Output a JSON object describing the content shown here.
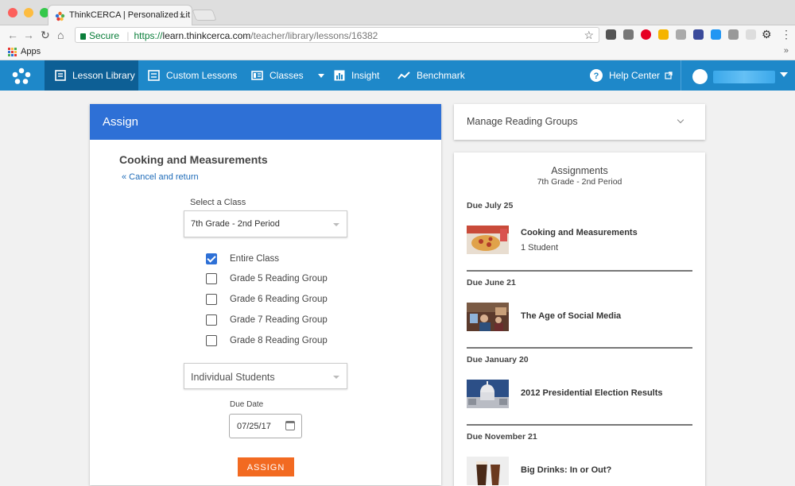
{
  "browser": {
    "tab_title": "ThinkCERCA | Personalized Lit",
    "secure_label": "Secure",
    "url_scheme": "https://",
    "url_host": "learn.thinkcerca.com",
    "url_path": "/teacher/library/lessons/16382",
    "bookmarks": {
      "apps_label": "Apps",
      "more": "»"
    }
  },
  "nav": {
    "items": [
      {
        "label": "Lesson Library"
      },
      {
        "label": "Custom Lessons"
      },
      {
        "label": "Classes"
      },
      {
        "label": "Insight"
      },
      {
        "label": "Benchmark"
      }
    ],
    "help_label": "Help Center",
    "colors": {
      "bar": "#1e88c9",
      "active": "#0d5f95"
    }
  },
  "assign_panel": {
    "header": "Assign",
    "lesson_title": "Cooking and Measurements",
    "cancel_link": "« Cancel and return",
    "select_label": "Select a Class",
    "selected_class": "7th Grade - 2nd Period",
    "groups": [
      {
        "label": "Entire Class",
        "checked": true
      },
      {
        "label": "Grade 5 Reading Group",
        "checked": false
      },
      {
        "label": "Grade 6 Reading Group",
        "checked": false
      },
      {
        "label": "Grade 7 Reading Group",
        "checked": false
      },
      {
        "label": "Grade 8 Reading Group",
        "checked": false
      }
    ],
    "students_select": "Individual Students",
    "due_label": "Due Date",
    "due_value": "07/25/17",
    "assign_button": "ASSIGN",
    "colors": {
      "header": "#2e70d6",
      "button": "#f26a21"
    }
  },
  "groups_panel": {
    "label": "Manage Reading Groups"
  },
  "assignments_panel": {
    "title": "Assignments",
    "subtitle": "7th Grade - 2nd Period",
    "entries": [
      {
        "due": "Due July 25",
        "name": "Cooking and Measurements",
        "count": "1 Student"
      },
      {
        "due": "Due June 21",
        "name": "The Age of Social Media",
        "count": ""
      },
      {
        "due": "Due January 20",
        "name": "2012 Presidential Election Results",
        "count": ""
      },
      {
        "due": "Due November 21",
        "name": "Big Drinks: In or Out?",
        "count": ""
      }
    ]
  }
}
